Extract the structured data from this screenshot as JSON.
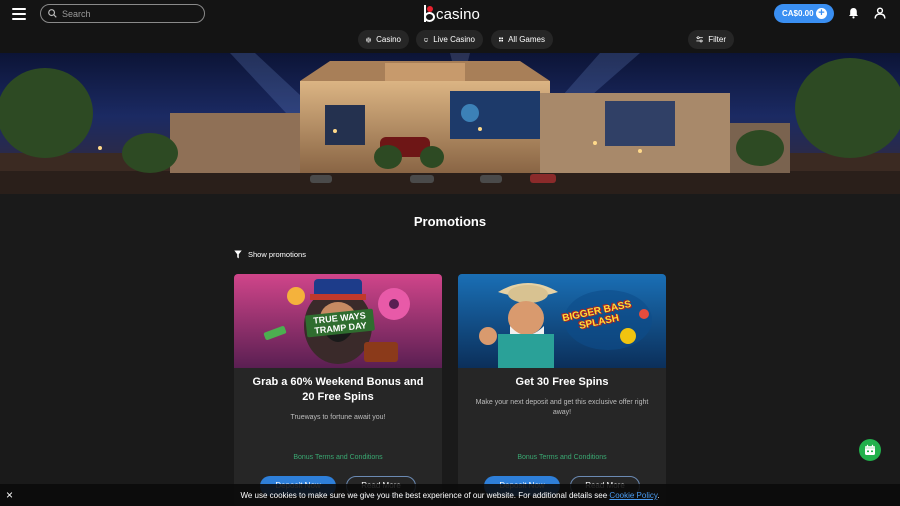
{
  "header": {
    "search_placeholder": "Search",
    "logo_text": "casino",
    "balance": "CA$0.00",
    "icons": [
      "hamburger-icon",
      "search-icon",
      "plus-icon",
      "bell-icon",
      "user-icon"
    ]
  },
  "nav": {
    "casino": "Casino",
    "live_casino": "Live Casino",
    "all_games": "All Games",
    "filter": "Filter"
  },
  "promotions": {
    "title": "Promotions",
    "show_promotions": "Show promotions",
    "cards": [
      {
        "image_text": "TRUE WAYS TRAMP DAY",
        "title": "Grab a 60% Weekend Bonus and 20 Free Spins",
        "description": "Trueways to fortune await you!",
        "terms": "Bonus Terms and Conditions",
        "deposit_label": "Deposit Now",
        "read_label": "Read More"
      },
      {
        "image_text": "BIGGER BASS SPLASH",
        "title": "Get 30 Free Spins",
        "description": "Make your next deposit and get this exclusive offer right away!",
        "terms": "Bonus Terms and Conditions",
        "deposit_label": "Deposit Now",
        "read_label": "Read More"
      }
    ]
  },
  "cookie": {
    "text": "We use cookies to make sure we give you the best experience of our website. For additional details see ",
    "link": "Cookie Policy",
    "suffix": ".",
    "close": "×"
  },
  "colors": {
    "accent": "#3a8ff2",
    "background": "#1a1a1a",
    "card": "#262626",
    "terms_green": "#3aa872",
    "chat_green": "#22b14c",
    "logo_dot": "#e8212e"
  }
}
